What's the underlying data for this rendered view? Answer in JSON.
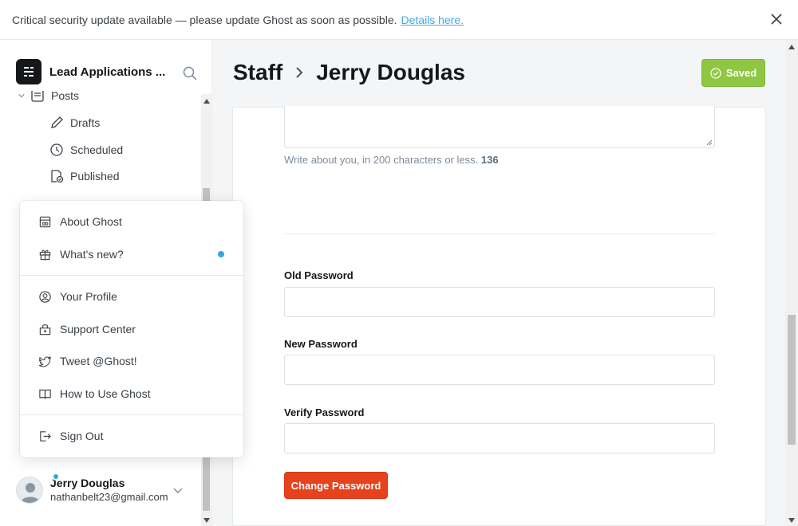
{
  "banner": {
    "message": "Critical security update available — please update Ghost as soon as possible.",
    "link": "Details here."
  },
  "sidebar": {
    "site_name": "Lead Applications ...",
    "nav": {
      "posts": "Posts",
      "drafts": "Drafts",
      "scheduled": "Scheduled",
      "published": "Published"
    },
    "user": {
      "name": "Jerry Douglas",
      "email": "nathanbelt23@gmail.com"
    }
  },
  "popup": {
    "about": "About Ghost",
    "whats_new": "What's new?",
    "profile": "Your Profile",
    "support": "Support Center",
    "tweet": "Tweet @Ghost!",
    "how_to": "How to Use Ghost",
    "sign_out": "Sign Out"
  },
  "header": {
    "crumb": "Staff",
    "title": "Jerry Douglas",
    "saved_label": "Saved"
  },
  "form": {
    "bio_hint": "Write about you, in 200 characters or less.",
    "bio_count": "136",
    "old_password_label": "Old Password",
    "new_password_label": "New Password",
    "verify_password_label": "Verify Password",
    "change_password_button": "Change Password"
  },
  "colors": {
    "saved_green": "#8fc743",
    "danger_red": "#e5421d",
    "accent_blue": "#30a7e3"
  }
}
